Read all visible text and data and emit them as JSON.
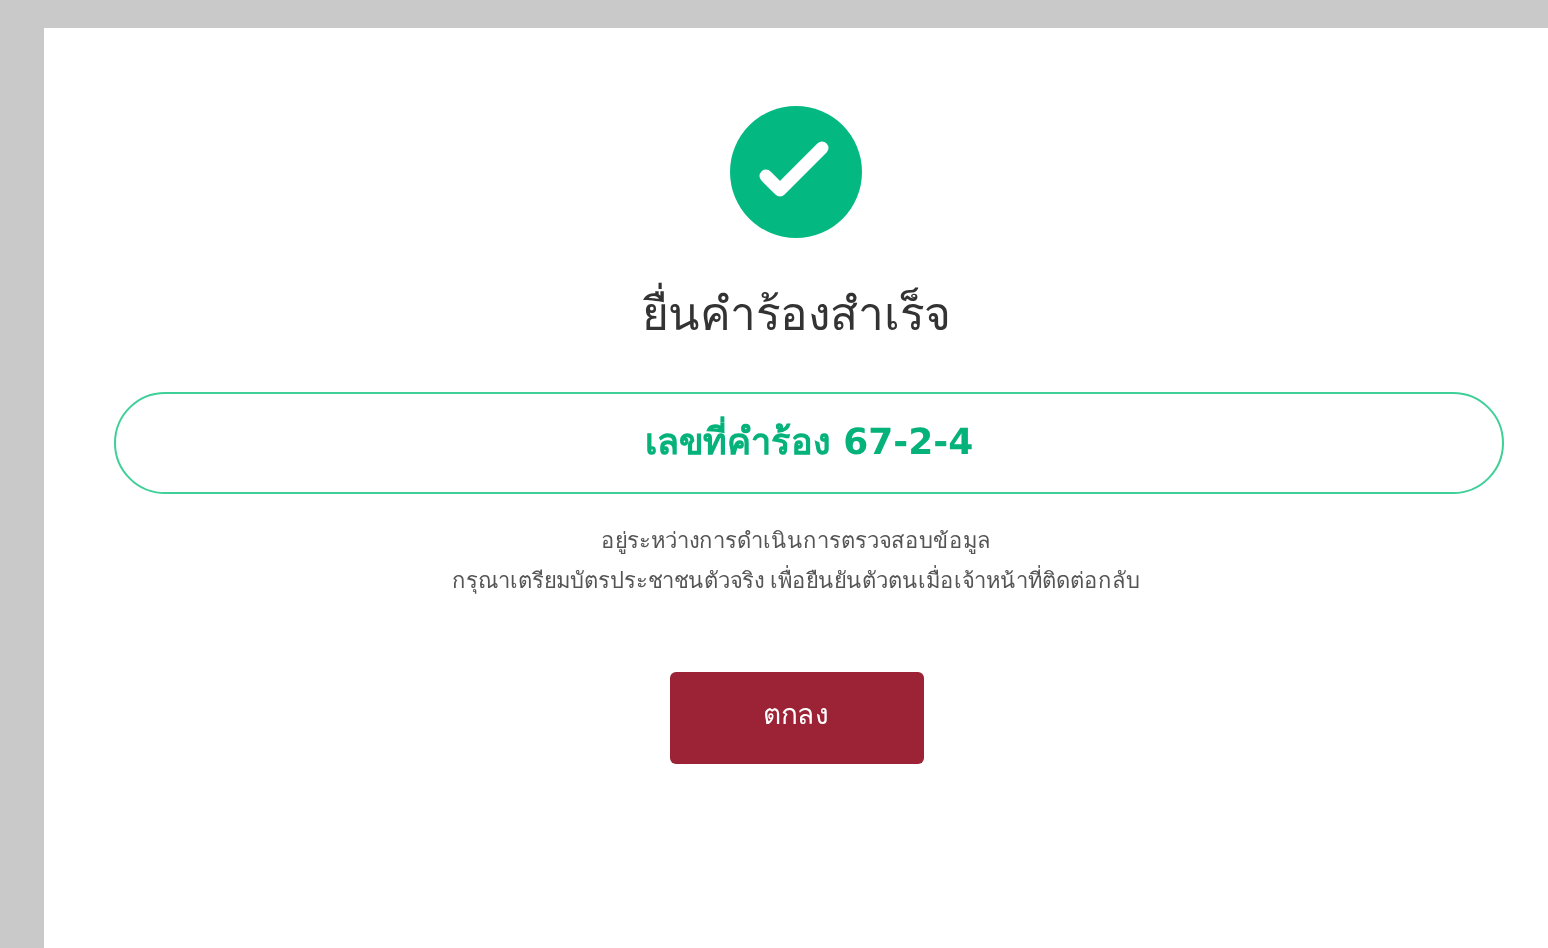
{
  "dialog": {
    "title": "ยื่นคำร้องสำเร็จ",
    "request_number": "เลขที่คำร้อง 67-2-4",
    "message_lines": [
      "อยู่ระหว่างการดำเนินการตรวจสอบข้อมูล",
      "กรุณาเตรียมบัตรประชาชนตัวจริง เพื่อยืนยันตัวตนเมื่อเจ้าหน้าที่ติดต่อกลับ"
    ],
    "button": "ตกลง"
  }
}
